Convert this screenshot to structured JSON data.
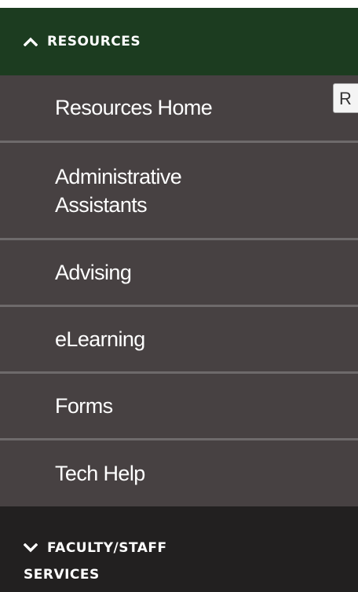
{
  "nav": {
    "resources_section": {
      "label": "Resources",
      "state": "expanded",
      "icon": "chevron-up-icon",
      "background": "#1c3c20"
    },
    "items": [
      {
        "label": "Resources Home"
      },
      {
        "label_line1": "Administrative",
        "label_line2": "Assistants"
      },
      {
        "label": "Advising"
      },
      {
        "label": "eLearning"
      },
      {
        "label": "Forms"
      },
      {
        "label": "Tech Help"
      }
    ],
    "faculty_section": {
      "label_line1": "Faculty/Staff",
      "label_line2": "Services",
      "state": "collapsed",
      "icon": "chevron-down-icon",
      "background": "#222020"
    },
    "item_background": "#474142",
    "divider_color": "#6e6a6b"
  },
  "tooltip": {
    "text": "R"
  }
}
